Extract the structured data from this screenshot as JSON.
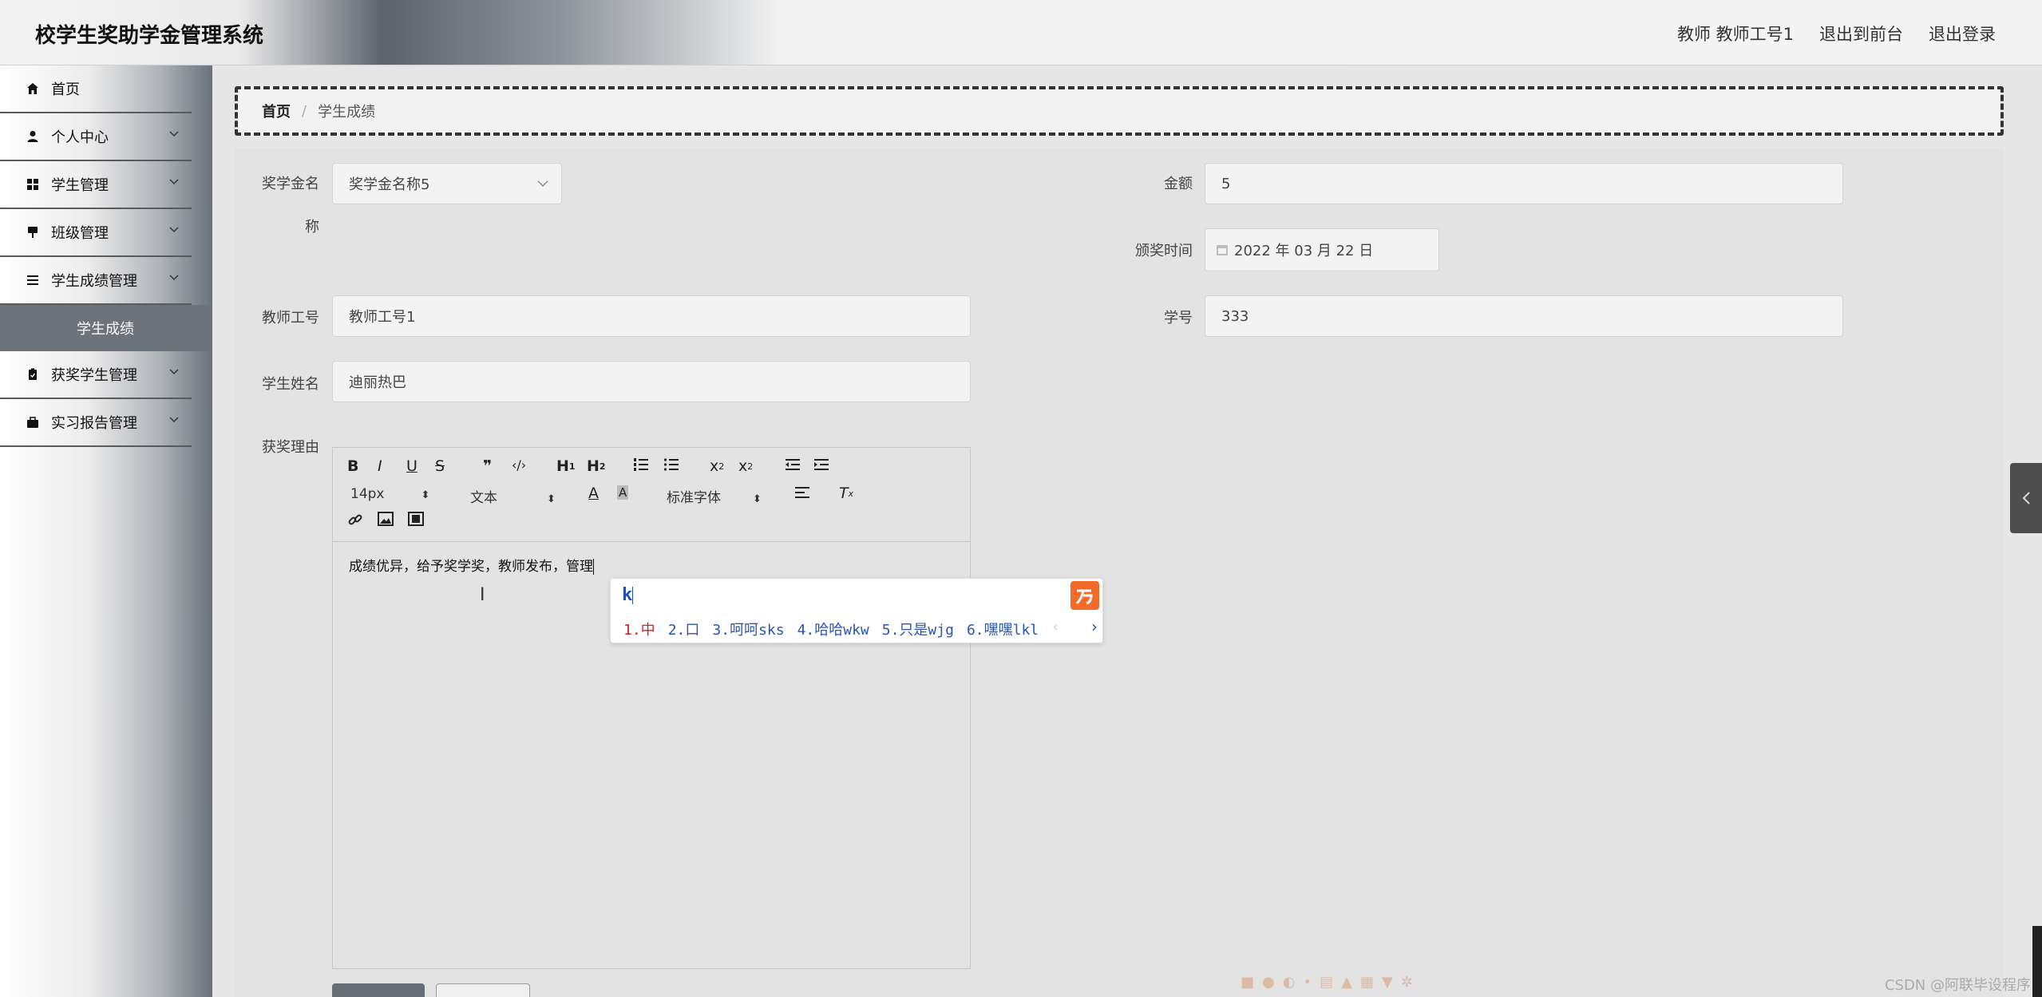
{
  "header": {
    "title": "校学生奖助学金管理系统",
    "user": "教师 教师工号1",
    "to_front": "退出到前台",
    "logout": "退出登录"
  },
  "sidebar": {
    "items": [
      {
        "label": "首页",
        "icon": "home-icon"
      },
      {
        "label": "个人中心",
        "icon": "user-icon"
      },
      {
        "label": "学生管理",
        "icon": "grid-icon"
      },
      {
        "label": "班级管理",
        "icon": "pushpin-icon"
      },
      {
        "label": "学生成绩管理",
        "icon": "list-icon"
      },
      {
        "label": "获奖学生管理",
        "icon": "clipboard-icon"
      },
      {
        "label": "实习报告管理",
        "icon": "briefcase-icon"
      }
    ],
    "active_sub": "学生成绩"
  },
  "breadcrumb": {
    "home": "首页",
    "separator": "/",
    "current": "学生成绩"
  },
  "form": {
    "scholarship_label_1": "奖学金名",
    "scholarship_label_2": "称",
    "scholarship_value": "奖学金名称5",
    "amount_label": "金额",
    "amount_value": "5",
    "award_time_label": "颁奖时间",
    "award_time_value": "2022 年 03 月 22 日",
    "teacher_id_label": "教师工号",
    "teacher_id_value": "教师工号1",
    "student_no_label": "学号",
    "student_no_value": "333",
    "student_name_label": "学生姓名",
    "student_name_value": "迪丽热巴",
    "reason_label": "获奖理由"
  },
  "editor": {
    "font_size": "14px",
    "block_format": "文本",
    "font_family": "标准字体",
    "content": "成绩优异，给予奖学奖，教师发布，管理"
  },
  "ime": {
    "input": "k",
    "candidates": [
      "1.中",
      "2.口",
      "3.呵呵sks",
      "4.哈哈wkw",
      "5.只是wjg",
      "6.嘿嘿lkl"
    ]
  },
  "watermark": "CSDN @阿联毕设程序"
}
